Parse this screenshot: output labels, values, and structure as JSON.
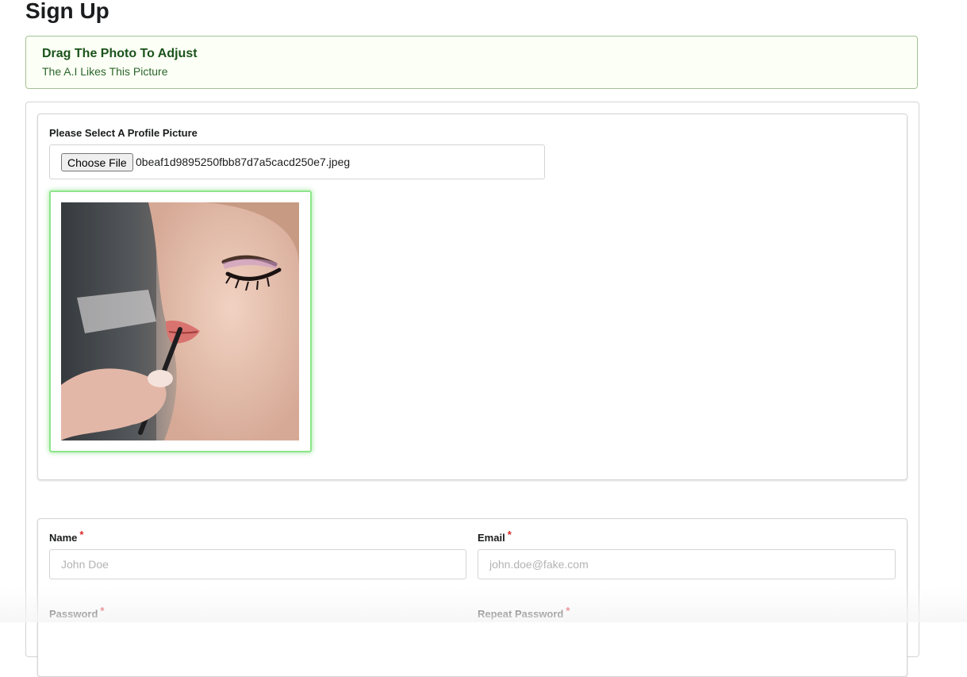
{
  "page": {
    "title": "Sign Up"
  },
  "notice": {
    "header": "Drag The Photo To Adjust",
    "text": "The A.I Likes This Picture",
    "colors": {
      "border": "#a3c293",
      "background": "#fcfff5",
      "header": "#1a531b"
    }
  },
  "profile_picture": {
    "label": "Please Select A Profile Picture",
    "choose_button": "Choose File",
    "file_name": "0beaf1d9895250fbb87d7a5cacd250e7.jpeg",
    "photo_icon": "profile-photo",
    "frame_color": "#8ee58a"
  },
  "form": {
    "name": {
      "label": "Name",
      "required": "*",
      "placeholder": "John Doe"
    },
    "email": {
      "label": "Email",
      "required": "*",
      "placeholder": "john.doe@fake.com"
    },
    "password": {
      "label": "Password",
      "required": "*"
    },
    "repeat_password": {
      "label": "Repeat Password",
      "required": "*"
    },
    "required_color": "#db2828"
  }
}
